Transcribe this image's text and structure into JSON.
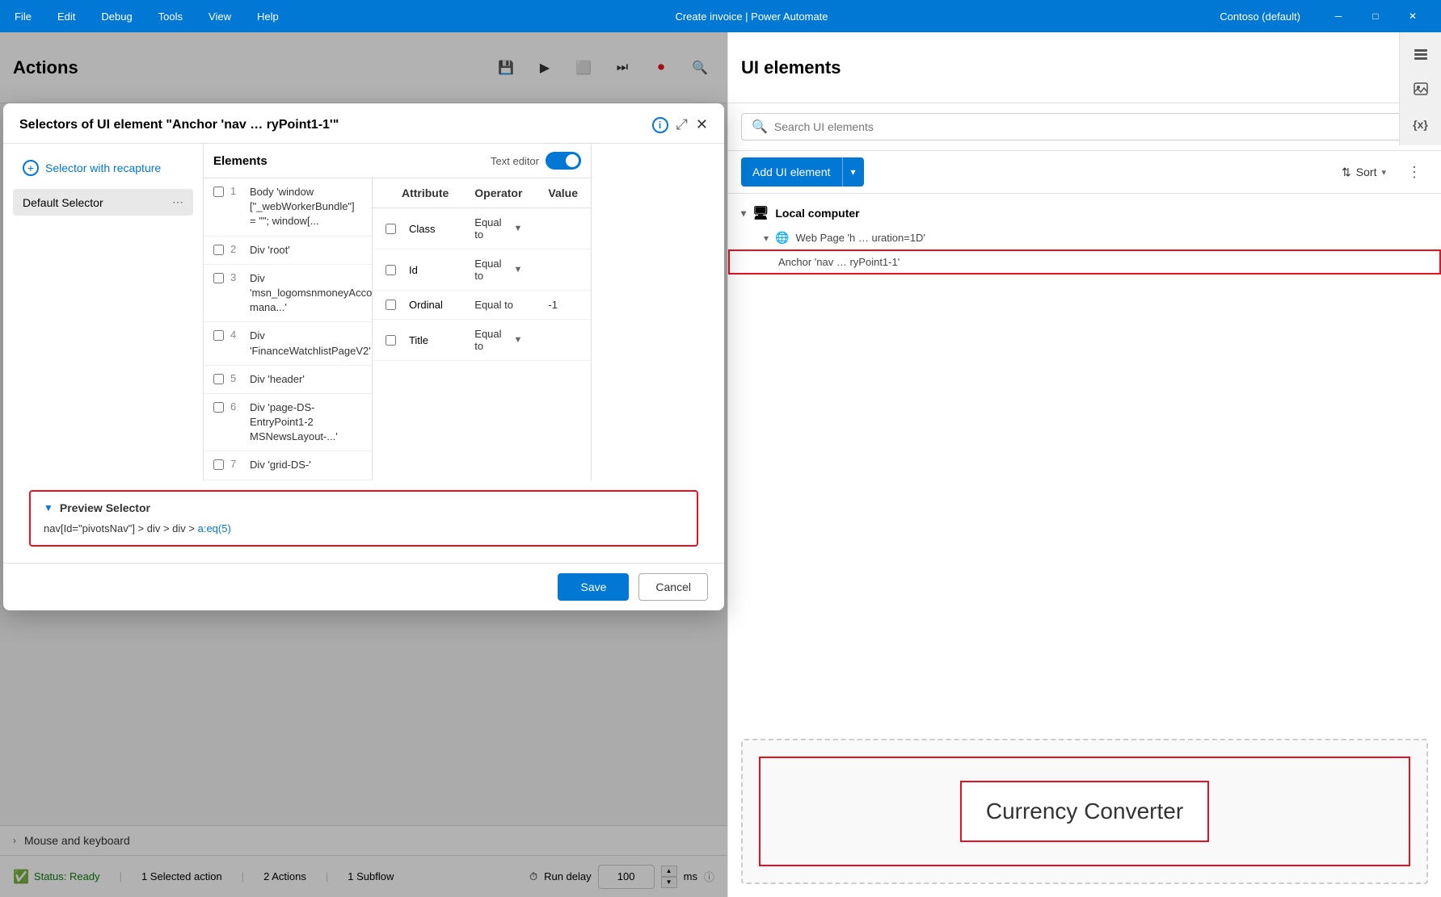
{
  "titleBar": {
    "menus": [
      "File",
      "Edit",
      "Debug",
      "Tools",
      "View",
      "Help"
    ],
    "title": "Create invoice | Power Automate",
    "user": "Contoso (default)",
    "controls": [
      "─",
      "□",
      "✕"
    ]
  },
  "actionsPanel": {
    "title": "Actions",
    "searchPlaceholder": "Search"
  },
  "dialog": {
    "title": "Selectors of UI element \"Anchor 'nav … ryPoint1-1'\"",
    "selectorLabel": "Selector with recapture",
    "defaultSelector": "Default Selector",
    "elementsHeader": "Elements",
    "textEditorLabel": "Text editor",
    "elements": [
      {
        "num": "1",
        "label": "Body 'window [\"_webWorkerBundle\"] = \"\"; window[..."
      },
      {
        "num": "2",
        "label": "Div 'root'"
      },
      {
        "num": "3",
        "label": "Div 'msn_logomsnmoneyAccount mana...'"
      },
      {
        "num": "4",
        "label": "Div 'FinanceWatchlistPageV2'"
      },
      {
        "num": "5",
        "label": "Div 'header'"
      },
      {
        "num": "6",
        "label": "Div 'page-DS-EntryPoint1-2 MSNewsLayout-...'"
      },
      {
        "num": "7",
        "label": "Div 'grid-DS-'"
      }
    ],
    "attributes": [
      {
        "name": "Class",
        "operator": "Equal to",
        "value": ""
      },
      {
        "name": "Id",
        "operator": "Equal to",
        "value": ""
      },
      {
        "name": "Ordinal",
        "operator": "Equal to",
        "value": "-1"
      },
      {
        "name": "Title",
        "operator": "Equal to",
        "value": ""
      }
    ],
    "attrHeaders": [
      "Attribute",
      "Operator",
      "Value"
    ],
    "previewLabel": "Preview Selector",
    "previewCode": "nav[Id=\"pivotsNav\"] > div > div > a:eq(5)",
    "previewCodeParts": {
      "normal": "nav[Id=\"pivotsNav\"] > div > div > ",
      "blue": "a:eq(5)"
    },
    "saveBtn": "Save",
    "cancelBtn": "Cancel"
  },
  "uiElements": {
    "title": "UI elements",
    "searchPlaceholder": "Search UI elements",
    "addButtonLabel": "Add UI element",
    "sortLabel": "Sort",
    "localComputer": "Local computer",
    "webPageLabel": "Web Page 'h … uration=1D'",
    "anchorLabel": "Anchor 'nav … ryPoint1-1'",
    "currencyConverter": "Currency Converter"
  },
  "statusBar": {
    "status": "Status: Ready",
    "selectedAction": "1 Selected action",
    "actions": "2 Actions",
    "subflow": "1 Subflow",
    "runDelayLabel": "Run delay",
    "runDelayValue": "100",
    "msLabel": "ms"
  },
  "bottomSection": {
    "mouseKeyboard": "Mouse and keyboard"
  }
}
